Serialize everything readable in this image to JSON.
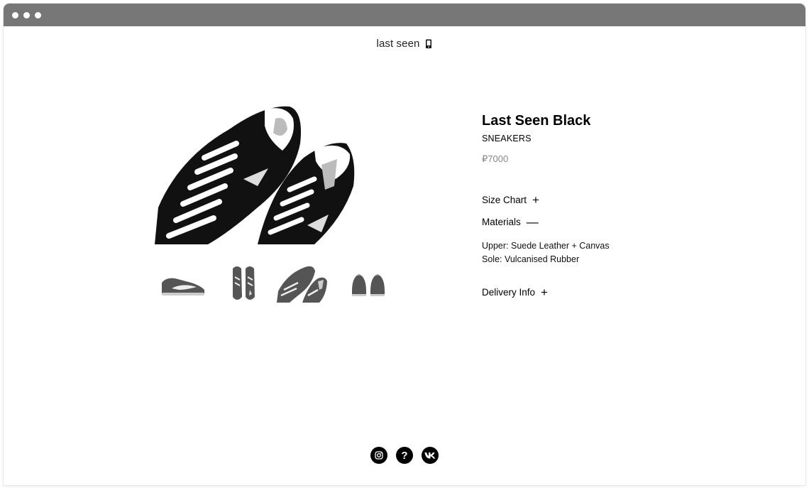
{
  "window": {
    "controls": [
      "close",
      "minimize",
      "maximize"
    ]
  },
  "header": {
    "brand": "last seen",
    "cart_icon": "phone-bag-icon"
  },
  "product": {
    "title": "Last Seen Black",
    "category": "SNEAKERS",
    "price": "₽7000",
    "main_image": "shoes-top-view",
    "thumbnails": [
      "shoe-side-view",
      "shoes-top-view-pair",
      "shoes-top-view-angled",
      "shoes-back-view"
    ]
  },
  "accordion": {
    "size_chart": {
      "label": "Size Chart",
      "symbol": "+"
    },
    "materials": {
      "label": "Materials",
      "symbol": "—",
      "lines": [
        "Upper: Suede Leather + Canvas",
        "Sole: Vulcanised Rubber"
      ]
    },
    "delivery": {
      "label": "Delivery Info",
      "symbol": "+"
    }
  },
  "footer": {
    "icons": [
      "instagram-icon",
      "help-icon",
      "vk-icon"
    ],
    "help_glyph": "?"
  },
  "colors": {
    "titlebar": "#777777",
    "price": "#888888",
    "text": "#000000"
  }
}
